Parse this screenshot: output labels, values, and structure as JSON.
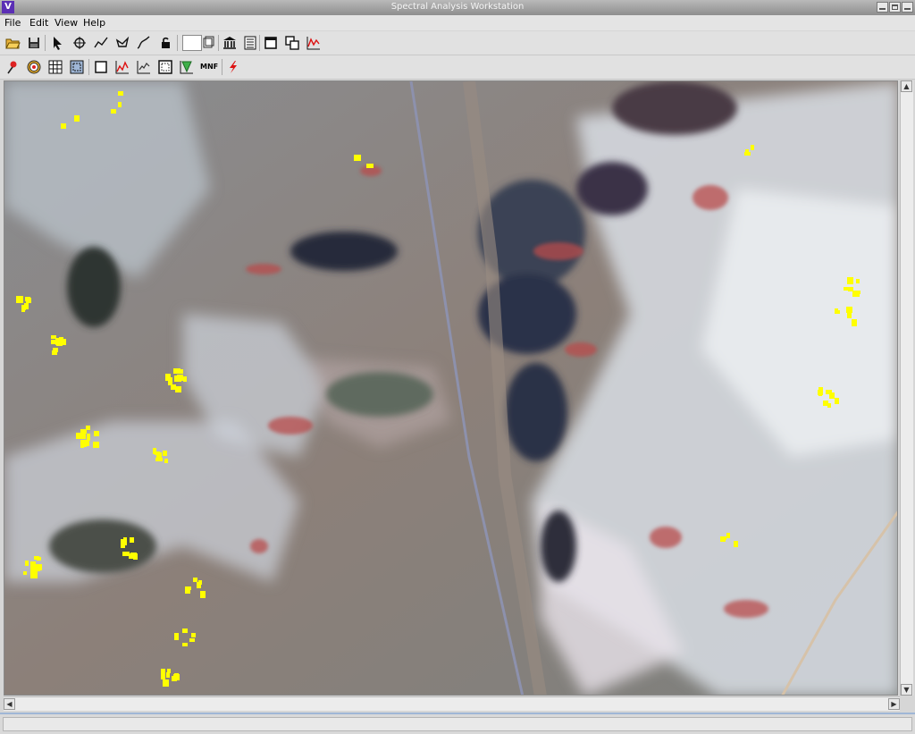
{
  "window": {
    "title": "Spectral Analysis Workstation"
  },
  "menu": [
    "File",
    "Edit",
    "View",
    "Help"
  ],
  "toolbar1": [
    "open-folder-icon",
    "save-icon",
    "arrow-pointer-icon",
    "crosshair-icon",
    "polyline-icon",
    "polygon-icon",
    "freehand-icon",
    "lock-icon",
    "blank-button",
    "pages-icon",
    "library-icon",
    "list-icon",
    "window-icon",
    "duplicate-window-icon",
    "spectrum-plot-icon"
  ],
  "toolbar2": [
    "pin-icon",
    "target-icon",
    "grid-icon",
    "crop-icon",
    "rectangle-icon",
    "histogram-icon",
    "scatter-plot-icon",
    "frame-icon",
    "green-fill-icon",
    "mnf-icon",
    "red-lightning-icon"
  ],
  "mnf_label": "MNF",
  "image": {
    "description_colors": {
      "highlight": "#ffff00",
      "dark_rock": "#2c3146",
      "alluvium": "#8f857d",
      "bright_playa": "#dfe4ea",
      "red_mineral": "#b84b4b"
    }
  },
  "status": {
    "text": ""
  }
}
